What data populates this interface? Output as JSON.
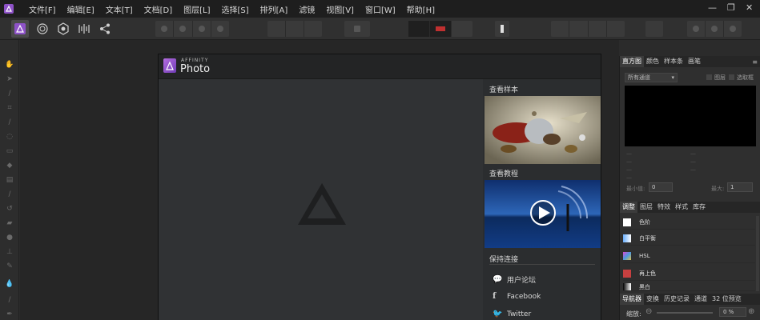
{
  "menubar": {
    "items": [
      "文件[F]",
      "编辑[E]",
      "文本[T]",
      "文档[D]",
      "图层[L]",
      "选择[S]",
      "排列[A]",
      "滤镜",
      "视图[V]",
      "窗口[W]",
      "帮助[H]"
    ],
    "window_controls": [
      "—",
      "❐",
      "✕"
    ]
  },
  "welcome": {
    "brand_small": "AFFINITY",
    "brand_big": "Photo",
    "view_samples": "查看样本",
    "view_tutorials": "查看教程",
    "stay_connected": "保持连接",
    "links": [
      {
        "label": "用户论坛",
        "icon": "forum-icon"
      },
      {
        "label": "Facebook",
        "icon": "facebook-icon"
      },
      {
        "label": "Twitter",
        "icon": "twitter-icon"
      }
    ]
  },
  "right_panel": {
    "top_tabs": [
      "直方图",
      "颜色",
      "样本条",
      "画笔"
    ],
    "channel_select": "所有通道",
    "layer_checkbox": "图层",
    "selection_checkbox": "选取框",
    "min_label": "最小值:",
    "min_value": "0",
    "max_label": "最大:",
    "max_value": "1",
    "adj_tabs": [
      "调整",
      "图层",
      "特效",
      "样式",
      "库存"
    ],
    "adjustments": [
      {
        "label": "色阶",
        "color": "#ffffff"
      },
      {
        "label": "白平衡",
        "color": "#e8e8e8"
      },
      {
        "label": "HSL",
        "color": "#d84ad8"
      },
      {
        "label": "再上色",
        "color": "#c84040"
      },
      {
        "label": "黑白",
        "color": "#cccccc"
      }
    ],
    "nav_tabs": [
      "导航器",
      "变换",
      "历史记录",
      "通道",
      "32 位预览"
    ],
    "zoom_label": "缩放:",
    "zoom_value": "0 %"
  }
}
